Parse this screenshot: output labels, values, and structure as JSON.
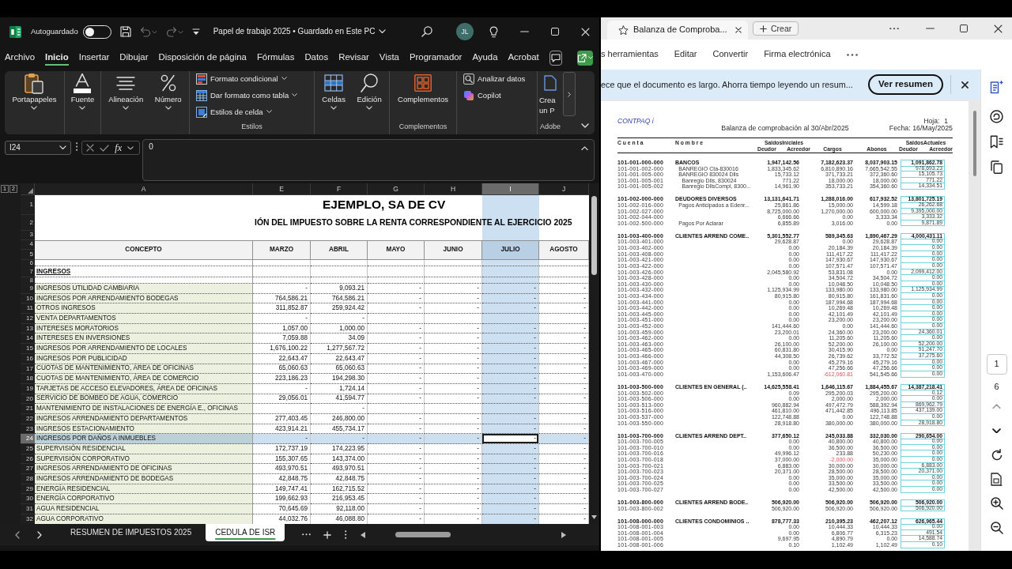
{
  "excel": {
    "title_bar": {
      "autosave_label": "Autoguardado",
      "autosave_on": false,
      "quick_access": [
        {
          "disabled": false
        },
        {
          "disabled": true
        },
        {
          "disabled": true
        },
        {
          "disabled": false
        }
      ],
      "document_title": "Papel de trabajo 2025 • Guardado en Este PC",
      "avatar_initials": "JL"
    },
    "ribbon_tabs": [
      {
        "label": "Archivo",
        "selected": false
      },
      {
        "label": "Inicio",
        "selected": true
      },
      {
        "label": "Insertar",
        "selected": false
      },
      {
        "label": "Dibujar",
        "selected": false
      },
      {
        "label": "Disposición de página",
        "selected": false
      },
      {
        "label": "Fórmulas",
        "selected": false
      },
      {
        "label": "Datos",
        "selected": false
      },
      {
        "label": "Revisar",
        "selected": false
      },
      {
        "label": "Vista",
        "selected": false
      },
      {
        "label": "Programador",
        "selected": false
      },
      {
        "label": "Ayuda",
        "selected": false
      },
      {
        "label": "Acrobat",
        "selected": false
      }
    ],
    "ribbon_groups": [
      {
        "buttons": [
          {
            "label": "Portapapeles",
            "dropdown": true
          }
        ]
      },
      {
        "buttons": [
          {
            "label": "Fuente",
            "dropdown": true
          }
        ]
      },
      {
        "buttons": [
          {
            "label": "Alineación",
            "dropdown": true
          },
          {
            "label": "Número",
            "dropdown": true
          }
        ]
      },
      {
        "label": "Estilos",
        "commands": [
          {
            "label": "Formato condicional",
            "dropdown": true
          },
          {
            "label": "Dar formato como tabla",
            "dropdown": true
          },
          {
            "label": "Estilos de celda",
            "dropdown": true
          }
        ]
      },
      {
        "buttons": [
          {
            "label": "Celdas",
            "dropdown": true
          },
          {
            "label": "Edición",
            "dropdown": true
          }
        ]
      },
      {
        "label": "Complementos",
        "buttons": [
          {
            "label": "Complementos",
            "dropdown": false
          }
        ]
      },
      {
        "commands": [
          {
            "label": "Analizar datos",
            "dropdown": false
          },
          {
            "label": "Copilot",
            "dropdown": false
          }
        ]
      },
      {
        "label": "Adobe",
        "buttons": [
          {
            "label": "Crea un P",
            "dropdown": false
          }
        ]
      }
    ],
    "formula_bar": {
      "name_box": "I24",
      "function_label": "fx",
      "formula": "0"
    },
    "outline_levels": [
      "1",
      "2"
    ],
    "columns": [
      {
        "label": "A",
        "selected": false
      },
      {
        "label": "E",
        "selected": false
      },
      {
        "label": "F",
        "selected": false
      },
      {
        "label": "G",
        "selected": false
      },
      {
        "label": "H",
        "selected": false
      },
      {
        "label": "I",
        "selected": true
      },
      {
        "label": "J",
        "selected": false
      }
    ],
    "top_rows": [
      {
        "kind": "title",
        "number": "1",
        "text": "EJEMPLO, SA DE CV"
      },
      {
        "kind": "subtitle",
        "number": "2",
        "text": "IÓN DEL IMPUESTO SOBRE LA RENTA CORRESPONDIENTE AL EJERCICIO 2025"
      },
      {
        "kind": "blank",
        "number": "3"
      },
      {
        "kind": "header",
        "numbers": [
          "4",
          "5"
        ],
        "cells": [
          "CONCEPTO",
          "MARZO",
          "ABRIL",
          "MAYO",
          "JUNIO",
          "JULIO",
          "AGOSTO"
        ]
      },
      {
        "kind": "blank",
        "number": "6"
      },
      {
        "kind": "section",
        "number": "7",
        "text": "INGRESOS"
      },
      {
        "kind": "blank",
        "number": "8"
      }
    ],
    "rows": [
      {
        "number": "9",
        "selected": false,
        "cells": [
          "INGRESOS UTILIDAD CAMBIARIA",
          "-",
          "9,093.21",
          "-",
          "-",
          "-",
          "-"
        ]
      },
      {
        "number": "10",
        "selected": false,
        "cells": [
          "INGRESOS POR ARRENDAMIENTO BODEGAS",
          "764,586.21",
          "764,586.21",
          "-",
          "-",
          "-",
          "-"
        ]
      },
      {
        "number": "11",
        "selected": false,
        "cells": [
          "OTROS INGRESOS",
          "311,852.87",
          "259,924.42",
          "-",
          "-",
          "-",
          "-"
        ]
      },
      {
        "number": "12",
        "selected": false,
        "cells": [
          "VENTA DEPARTAMENTOS",
          "-",
          "-",
          null,
          null,
          null,
          null
        ]
      },
      {
        "number": "13",
        "selected": false,
        "cells": [
          "INTERESES MORATORIOS",
          "1,057.00",
          "1,000.00",
          "-",
          "-",
          "-",
          "-"
        ]
      },
      {
        "number": "14",
        "selected": false,
        "cells": [
          "INTERESES EN INVERSIONES",
          "7,059.88",
          "34.09",
          "-",
          "-",
          "-",
          "-"
        ]
      },
      {
        "number": "15",
        "selected": false,
        "cells": [
          "INGRESOS POR ARRENDAMIENTO DE LOCALES",
          "1,676,100.22",
          "1,277,567.72",
          "-",
          "-",
          "-",
          "-"
        ]
      },
      {
        "number": "16",
        "selected": false,
        "cells": [
          "INGRESOS POR PUBLICIDAD",
          "22,643.47",
          "22,643.47",
          "-",
          "-",
          "-",
          "-"
        ]
      },
      {
        "number": "17",
        "selected": false,
        "cells": [
          "CUOTAS DE MANTENIMIENTO, ÁREA DE OFICINAS",
          "65,060.63",
          "65,060.63",
          "-",
          "-",
          "-",
          "-"
        ]
      },
      {
        "number": "18",
        "selected": false,
        "cells": [
          "CUOTAS DE MANTENIMIENTO, ÁREA DE COMERCIO",
          "223,186.23",
          "194,298.30",
          "-",
          "-",
          "-",
          "-"
        ]
      },
      {
        "number": "19",
        "selected": false,
        "cells": [
          "TARJETAS DE ACCESO ELEVADORES, ÁREA DE OFICINAS",
          "-",
          "1,724.14",
          "-",
          "-",
          "-",
          "-"
        ]
      },
      {
        "number": "20",
        "selected": false,
        "cells": [
          "SERVICIO DE BOMBEO DE AGUA, COMERCIO",
          "29,056.01",
          "41,594.77",
          "-",
          "-",
          "-",
          "-"
        ]
      },
      {
        "number": "21",
        "selected": false,
        "cells": [
          "MANTENIMIENTO DE INSTALACIONES DE ENERGÍA E., OFICINAS",
          null,
          "-",
          null,
          null,
          null,
          null
        ]
      },
      {
        "number": "22",
        "selected": false,
        "cells": [
          "INGRESOS ARRENDAMIENTO DEPARTAMENTOS",
          "277,403.45",
          "246,800.00",
          "-",
          "-",
          "-",
          "-"
        ]
      },
      {
        "number": "23",
        "selected": false,
        "cells": [
          "INGRESOS ESTACIONAMIENTO",
          "423,914.21",
          "455,734.17",
          "-",
          "-",
          "-",
          "-"
        ]
      },
      {
        "number": "24",
        "selected": true,
        "cells": [
          "INGRESOS POR DAÑOS A INMUEBLES",
          "-",
          "-",
          "-",
          "-",
          "-",
          "-"
        ]
      },
      {
        "number": "25",
        "selected": false,
        "cells": [
          "SUPERVISIÓN RESIDENCIAL",
          "172,737.19",
          "174,223.95",
          "-",
          "-",
          "-",
          "-"
        ]
      },
      {
        "number": "26",
        "selected": false,
        "cells": [
          "SUPERVISIÓN CORPORATIVO",
          "155,307.65",
          "143,374.00",
          "-",
          "-",
          "-",
          "-"
        ]
      },
      {
        "number": "27",
        "selected": false,
        "cells": [
          "INGRESOS ARRENDAMIENTO DE OFICINAS",
          "493,970.51",
          "493,970.51",
          "-",
          "-",
          "-",
          "-"
        ]
      },
      {
        "number": "28",
        "selected": false,
        "cells": [
          "INGRESOS ARRENDAMIENTO DE BODEGAS",
          "42,848.75",
          "42,848.75",
          "-",
          "-",
          "-",
          "-"
        ]
      },
      {
        "number": "29",
        "selected": false,
        "cells": [
          "ENERGÍA RESIDENCIAL",
          "149,747.41",
          "162,715.52",
          "-",
          "-",
          "-",
          "-"
        ]
      },
      {
        "number": "30",
        "selected": false,
        "cells": [
          "ENERGÍA CORPORATIVO",
          "199,662.93",
          "216,953.45",
          "-",
          "-",
          "-",
          "-"
        ]
      },
      {
        "number": "31",
        "selected": false,
        "cells": [
          "AGUA RESIDENCIAL",
          "70,645.69",
          "92,118.00",
          "-",
          "-",
          "-",
          "-"
        ]
      },
      {
        "number": "32",
        "selected": false,
        "cells": [
          "AGUA CORPORATIVO",
          "44,032.76",
          "46,088.80",
          "-",
          "-",
          "-",
          "-"
        ]
      }
    ],
    "sheet_tabs": [
      {
        "label": "RESUMEN DE IMPUESTOS 2025",
        "selected": false
      },
      {
        "label": "CEDULA DE ISR",
        "selected": true
      }
    ]
  },
  "pdf_viewer": {
    "tab_title": "Balanza de Comproba...",
    "new_button": "Crear",
    "toolbar": [
      "s herramientas",
      "Editar",
      "Convertir",
      "Firma electrónica"
    ],
    "banner": {
      "message": "ece que el documento es largo. Ahorra tiempo leyendo un resum...",
      "action": "Ver resumen"
    },
    "document": {
      "brand": "CONTPAQ i",
      "page_label": "Hoja:",
      "page_number": "1",
      "title": "Balanza de comprobación al 30/Abr/2025",
      "date": "Fecha: 16/May/2025",
      "columns": {
        "account": "C u e n t a",
        "name": "N o m b r e",
        "opening_balance": "SaldosIniciales",
        "opening_debit": "Deudor",
        "opening_credit": "Acreedor",
        "debits": "Cargos",
        "credits": "Abonos",
        "closing_balance": "SaldosActuales",
        "closing_debit": "Deudor",
        "closing_credit": "Acreedor"
      },
      "accounts": [
        {
          "cells": [
            "101-001-000-000",
            "BANCOS",
            "1,947,142.56",
            "7,182,623.37",
            "8,037,903.15",
            "1,091,862.78"
          ],
          "children": [
            {
              "cells": [
                "101-001-002-000",
                "BANREGIO Cta-830016",
                "1,833,345.62",
                "6,810,890.16",
                "7,665,542.55",
                "978,693.23"
              ]
            },
            {
              "cells": [
                "101-001-005-000",
                "BANREGIO 830024 Dlls",
                "15,733.12",
                "371,733.21",
                "372,360.60",
                "15,105.73"
              ],
              "children": [
                {
                  "cells": [
                    "101-001-005-001",
                    "Banregio Dlls, 830024",
                    "771.22",
                    "18,000.00",
                    "18,000.00",
                    "771.22"
                  ]
                },
                {
                  "cells": [
                    "101-001-005-002",
                    "Banregio DllsCompl, 8300...",
                    "14,961.90",
                    "353,733.21",
                    "354,360.60",
                    "14,334.51"
                  ]
                }
              ]
            }
          ]
        },
        {
          "cells": [
            "101-002-000-000",
            "DEUDORES DIVERSOS",
            "13,131,641.71",
            "1,288,016.00",
            "617,932.52",
            "13,801,725.19"
          ],
          "children": [
            {
              "cells": [
                "101-002-016-000",
                "Pagos Anticipados a Edenr...",
                "25,861.86",
                "15,000.00",
                "14,599.18",
                "26,262.68"
              ]
            },
            {
              "cells": [
                "101-002-027-000",
                null,
                "8,725,000.00",
                "1,270,000.00",
                "600,000.00",
                "9,395,000.00"
              ]
            },
            {
              "cells": [
                "101-002-044-000",
                null,
                "6,666.66",
                "0.00",
                "3,333.34",
                "3,333.32"
              ]
            },
            {
              "cells": [
                "101-002-500-000",
                "Pagos Por Aclarar",
                "6,855.89",
                "3,016.00",
                "0.00",
                "9,871.89"
              ]
            }
          ]
        },
        {
          "cells": [
            "101-003-400-000",
            "CLIENTES ARREND COME..",
            "5,301,552.77",
            "589,345.63",
            "1,890,467.29",
            "4,000,431.11"
          ],
          "children": [
            {
              "cells": [
                "101-003-401-000",
                null,
                "29,628.87",
                "0.00",
                "29,628.87",
                "0.00"
              ]
            },
            {
              "cells": [
                "101-003-402-000",
                null,
                "0.00",
                "20,184.39",
                "20,184.39",
                "0.00"
              ]
            },
            {
              "cells": [
                "101-003-408-000",
                null,
                "0.00",
                "111,417.22",
                "111,417.22",
                "0.00"
              ]
            },
            {
              "cells": [
                "101-003-421-000",
                null,
                "0.00",
                "147,930.67",
                "147,930.67",
                "0.00"
              ]
            },
            {
              "cells": [
                "101-003-422-000",
                null,
                "0.00",
                "107,571.47",
                "107,571.47",
                "0.00"
              ]
            },
            {
              "cells": [
                "101-003-426-000",
                null,
                "2,045,580.92",
                "53,831.08",
                "0.00",
                "2,099,412.00"
              ]
            },
            {
              "cells": [
                "101-003-428-000",
                null,
                "0.00",
                "34,504.72",
                "34,504.72",
                "0.00"
              ]
            },
            {
              "cells": [
                "101-003-430-000",
                null,
                "0.00",
                "10,048.50",
                "10,048.50",
                "0.00"
              ]
            },
            {
              "cells": [
                "101-003-432-000",
                null,
                "1,125,934.99",
                "133,980.00",
                "133,980.00",
                "1,125,934.99"
              ]
            },
            {
              "cells": [
                "101-003-434-000",
                null,
                "80,915.80",
                "80,915.80",
                "161,831.60",
                "0.00"
              ]
            },
            {
              "cells": [
                "101-003-441-000",
                null,
                "0.00",
                "187,994.68",
                "187,994.68",
                "0.00"
              ]
            },
            {
              "cells": [
                "101-003-442-000",
                null,
                "0.00",
                "10,269.48",
                "10,269.48",
                "0.00"
              ]
            },
            {
              "cells": [
                "101-003-445-000",
                null,
                "0.00",
                "42,101.49",
                "42,101.49",
                "0.00"
              ]
            },
            {
              "cells": [
                "101-003-451-000",
                null,
                "0.00",
                "23,200.00",
                "23,200.00",
                "0.00"
              ]
            },
            {
              "cells": [
                "101-003-452-000",
                null,
                "141,444.60",
                "0.00",
                "141,444.60",
                "0.00"
              ]
            },
            {
              "cells": [
                "101-003-459-000",
                null,
                "23,200.01",
                "24,360.00",
                "23,200.00",
                "24,360.01"
              ]
            },
            {
              "cells": [
                "101-003-462-000",
                null,
                "0.00",
                "11,205.60",
                "11,205.60",
                "0.00"
              ]
            },
            {
              "cells": [
                "101-003-463-000",
                null,
                "26,100.00",
                "52,200.00",
                "26,100.00",
                "52,200.00"
              ]
            },
            {
              "cells": [
                "101-003-465-000",
                null,
                "60,831.80",
                "30,415.90",
                "0.00",
                "91,247.70"
              ]
            },
            {
              "cells": [
                "101-003-466-000",
                null,
                "44,308.50",
                "26,739.62",
                "33,772.52",
                "37,275.60"
              ]
            },
            {
              "cells": [
                "101-003-467-000",
                null,
                "0.00",
                "45,279.16",
                "45,279.16",
                "0.00"
              ]
            },
            {
              "cells": [
                "101-003-469-000",
                null,
                "0.00",
                "47,256.66",
                "47,256.66",
                "0.00"
              ]
            },
            {
              "cells": [
                "101-003-470-000",
                null,
                "1,153,606.47",
                "-612,060.81",
                "541,545.66",
                "0.00"
              ]
            }
          ]
        },
        {
          "cells": [
            "101-003-500-000",
            "CLIENTES EN GENERAL (..",
            "14,625,558.41",
            "1,646,115.67",
            "1,884,455.67",
            "14,387,218.41"
          ],
          "children": [
            {
              "cells": [
                "101-003-502-000",
                null,
                "0.09",
                "295,200.03",
                "295,200.00",
                "0.12"
              ]
            },
            {
              "cells": [
                "101-003-506-000",
                null,
                "0.00",
                "2,000.00",
                "2,000.00",
                "0.00"
              ]
            },
            {
              "cells": [
                "101-003-513-000",
                null,
                "960,882.94",
                "497,472.79",
                "588,392.94",
                "869,962.79"
              ]
            },
            {
              "cells": [
                "101-003-516-000",
                null,
                "461,810.00",
                "471,442.85",
                "496,113.85",
                "437,139.00"
              ]
            },
            {
              "cells": [
                "101-003-537-000",
                null,
                "122,748.88",
                "0.00",
                "122,748.88",
                "0.00"
              ]
            },
            {
              "cells": [
                "101-003-550-000",
                null,
                "28,918.80",
                "380,000.00",
                "380,000.00",
                "28,918.80"
              ]
            }
          ]
        },
        {
          "cells": [
            "101-003-700-000",
            "CLIENTES ARREND DEPT..",
            "377,650.12",
            "245,033.88",
            "332,030.00",
            "290,654.00"
          ],
          "children": [
            {
              "cells": [
                "101-003-700-005",
                null,
                "0.00",
                "40,800.00",
                "40,800.00",
                "0.00"
              ]
            },
            {
              "cells": [
                "101-003-700-010",
                null,
                "0.00",
                "36,500.00",
                "36,500.00",
                "0.00"
              ]
            },
            {
              "cells": [
                "101-003-700-016",
                null,
                "49,996.12",
                "233.88",
                "50,230.00",
                "0.00"
              ]
            },
            {
              "cells": [
                "101-003-700-018",
                null,
                "37,000.00",
                "-2,000.00",
                "35,000.00",
                "0.00"
              ]
            },
            {
              "cells": [
                "101-003-700-021",
                null,
                "6,883.00",
                "30,000.00",
                "30,000.00",
                "6,883.00"
              ]
            },
            {
              "cells": [
                "101-003-700-023",
                null,
                "20,371.00",
                "28,500.00",
                "28,500.00",
                "20,371.00"
              ]
            },
            {
              "cells": [
                "101-003-700-024",
                null,
                "0.00",
                "35,000.00",
                "35,000.00",
                "0.00"
              ]
            },
            {
              "cells": [
                "101-003-700-025",
                null,
                "0.00",
                "33,500.00",
                "33,500.00",
                "0.00"
              ]
            },
            {
              "cells": [
                "101-003-700-027",
                null,
                "0.00",
                "42,500.00",
                "42,500.00",
                "0.00"
              ]
            }
          ]
        },
        {
          "cells": [
            "101-003-800-000",
            "CLIENTES ARREND BODE..",
            "506,920.00",
            "506,920.00",
            "506,920.00",
            "506,920.00"
          ],
          "children": [
            {
              "cells": [
                "101-003-800-002",
                null,
                "506,920.00",
                "506,920.00",
                "506,920.00",
                "506,920.00"
              ]
            }
          ]
        },
        {
          "cells": [
            "101-008-000-000",
            "CLIENTES CONDOMINIOS ..",
            "878,777.33",
            "210,395.23",
            "462,207.12",
            "626,965.44"
          ],
          "children": [
            {
              "cells": [
                "101-008-001-003",
                null,
                "0.00",
                "10,444.33",
                "10,444.33",
                "0.00"
              ]
            },
            {
              "cells": [
                "101-008-001-004",
                null,
                "0.00",
                "6,806.77",
                "6,315.23",
                "491.54"
              ]
            },
            {
              "cells": [
                "101-008-001-005",
                null,
                "9,697.95",
                "4,890.79",
                "0.00",
                "14,588.74"
              ]
            },
            {
              "cells": [
                "101-008-001-006",
                null,
                "0.10",
                "1,102.49",
                "1,102.49",
                "0.10"
              ]
            }
          ]
        }
      ]
    },
    "page_nav": {
      "current": "1",
      "total": "6"
    }
  }
}
